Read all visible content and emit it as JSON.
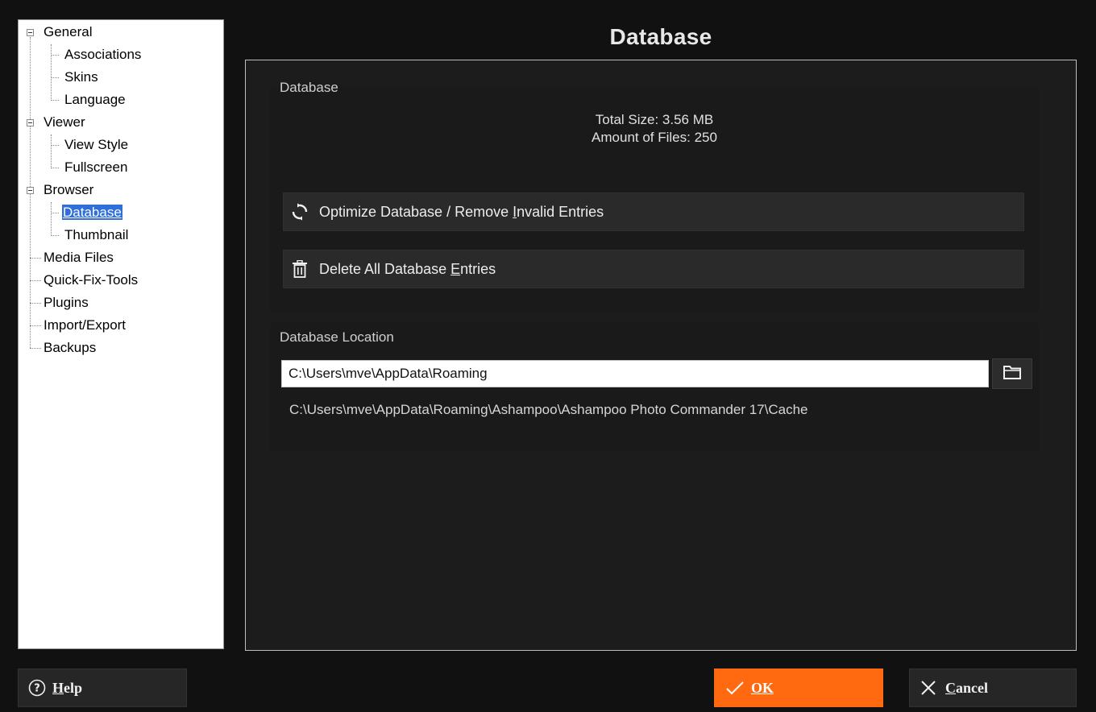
{
  "tree": {
    "items": [
      {
        "label": "General"
      },
      {
        "label": "Associations"
      },
      {
        "label": "Skins"
      },
      {
        "label": "Language"
      },
      {
        "label": "Viewer"
      },
      {
        "label": "View Style"
      },
      {
        "label": "Fullscreen"
      },
      {
        "label": "Browser"
      },
      {
        "label": "Database"
      },
      {
        "label": "Thumbnail"
      },
      {
        "label": "Media Files"
      },
      {
        "label": "Quick-Fix-Tools"
      },
      {
        "label": "Plugins"
      },
      {
        "label": "Import/Export"
      },
      {
        "label": "Backups"
      }
    ],
    "selected": "Database"
  },
  "page": {
    "title": "Database"
  },
  "database_group": {
    "title": "Database",
    "total_size": "Total Size: 3.56 MB",
    "amount_files": "Amount of Files: 250",
    "optimize_label_pre": "Optimize Database / Remove ",
    "optimize_label_ul": "I",
    "optimize_label_post": "nvalid Entries",
    "delete_label_pre": "Delete All Database ",
    "delete_label_ul": "E",
    "delete_label_post": "ntries"
  },
  "location_group": {
    "title": "Database Location",
    "path_value": "C:\\Users\\mve\\AppData\\Roaming",
    "full_path": "C:\\Users\\mve\\AppData\\Roaming\\Ashampoo\\Ashampoo Photo Commander 17\\Cache"
  },
  "footer": {
    "help_ul": "H",
    "help_rest": "elp",
    "ok_ul": "O",
    "ok_rest": "K",
    "cancel_ul": "C",
    "cancel_rest": "ancel"
  },
  "colors": {
    "accent": "#ff6a10",
    "selection": "#2f6fdb",
    "panel_bg": "#1c1c1c"
  },
  "icons": [
    "expander-minus-icon",
    "refresh-icon",
    "trash-icon",
    "folder-icon",
    "help-circle-icon",
    "check-icon",
    "close-icon"
  ]
}
